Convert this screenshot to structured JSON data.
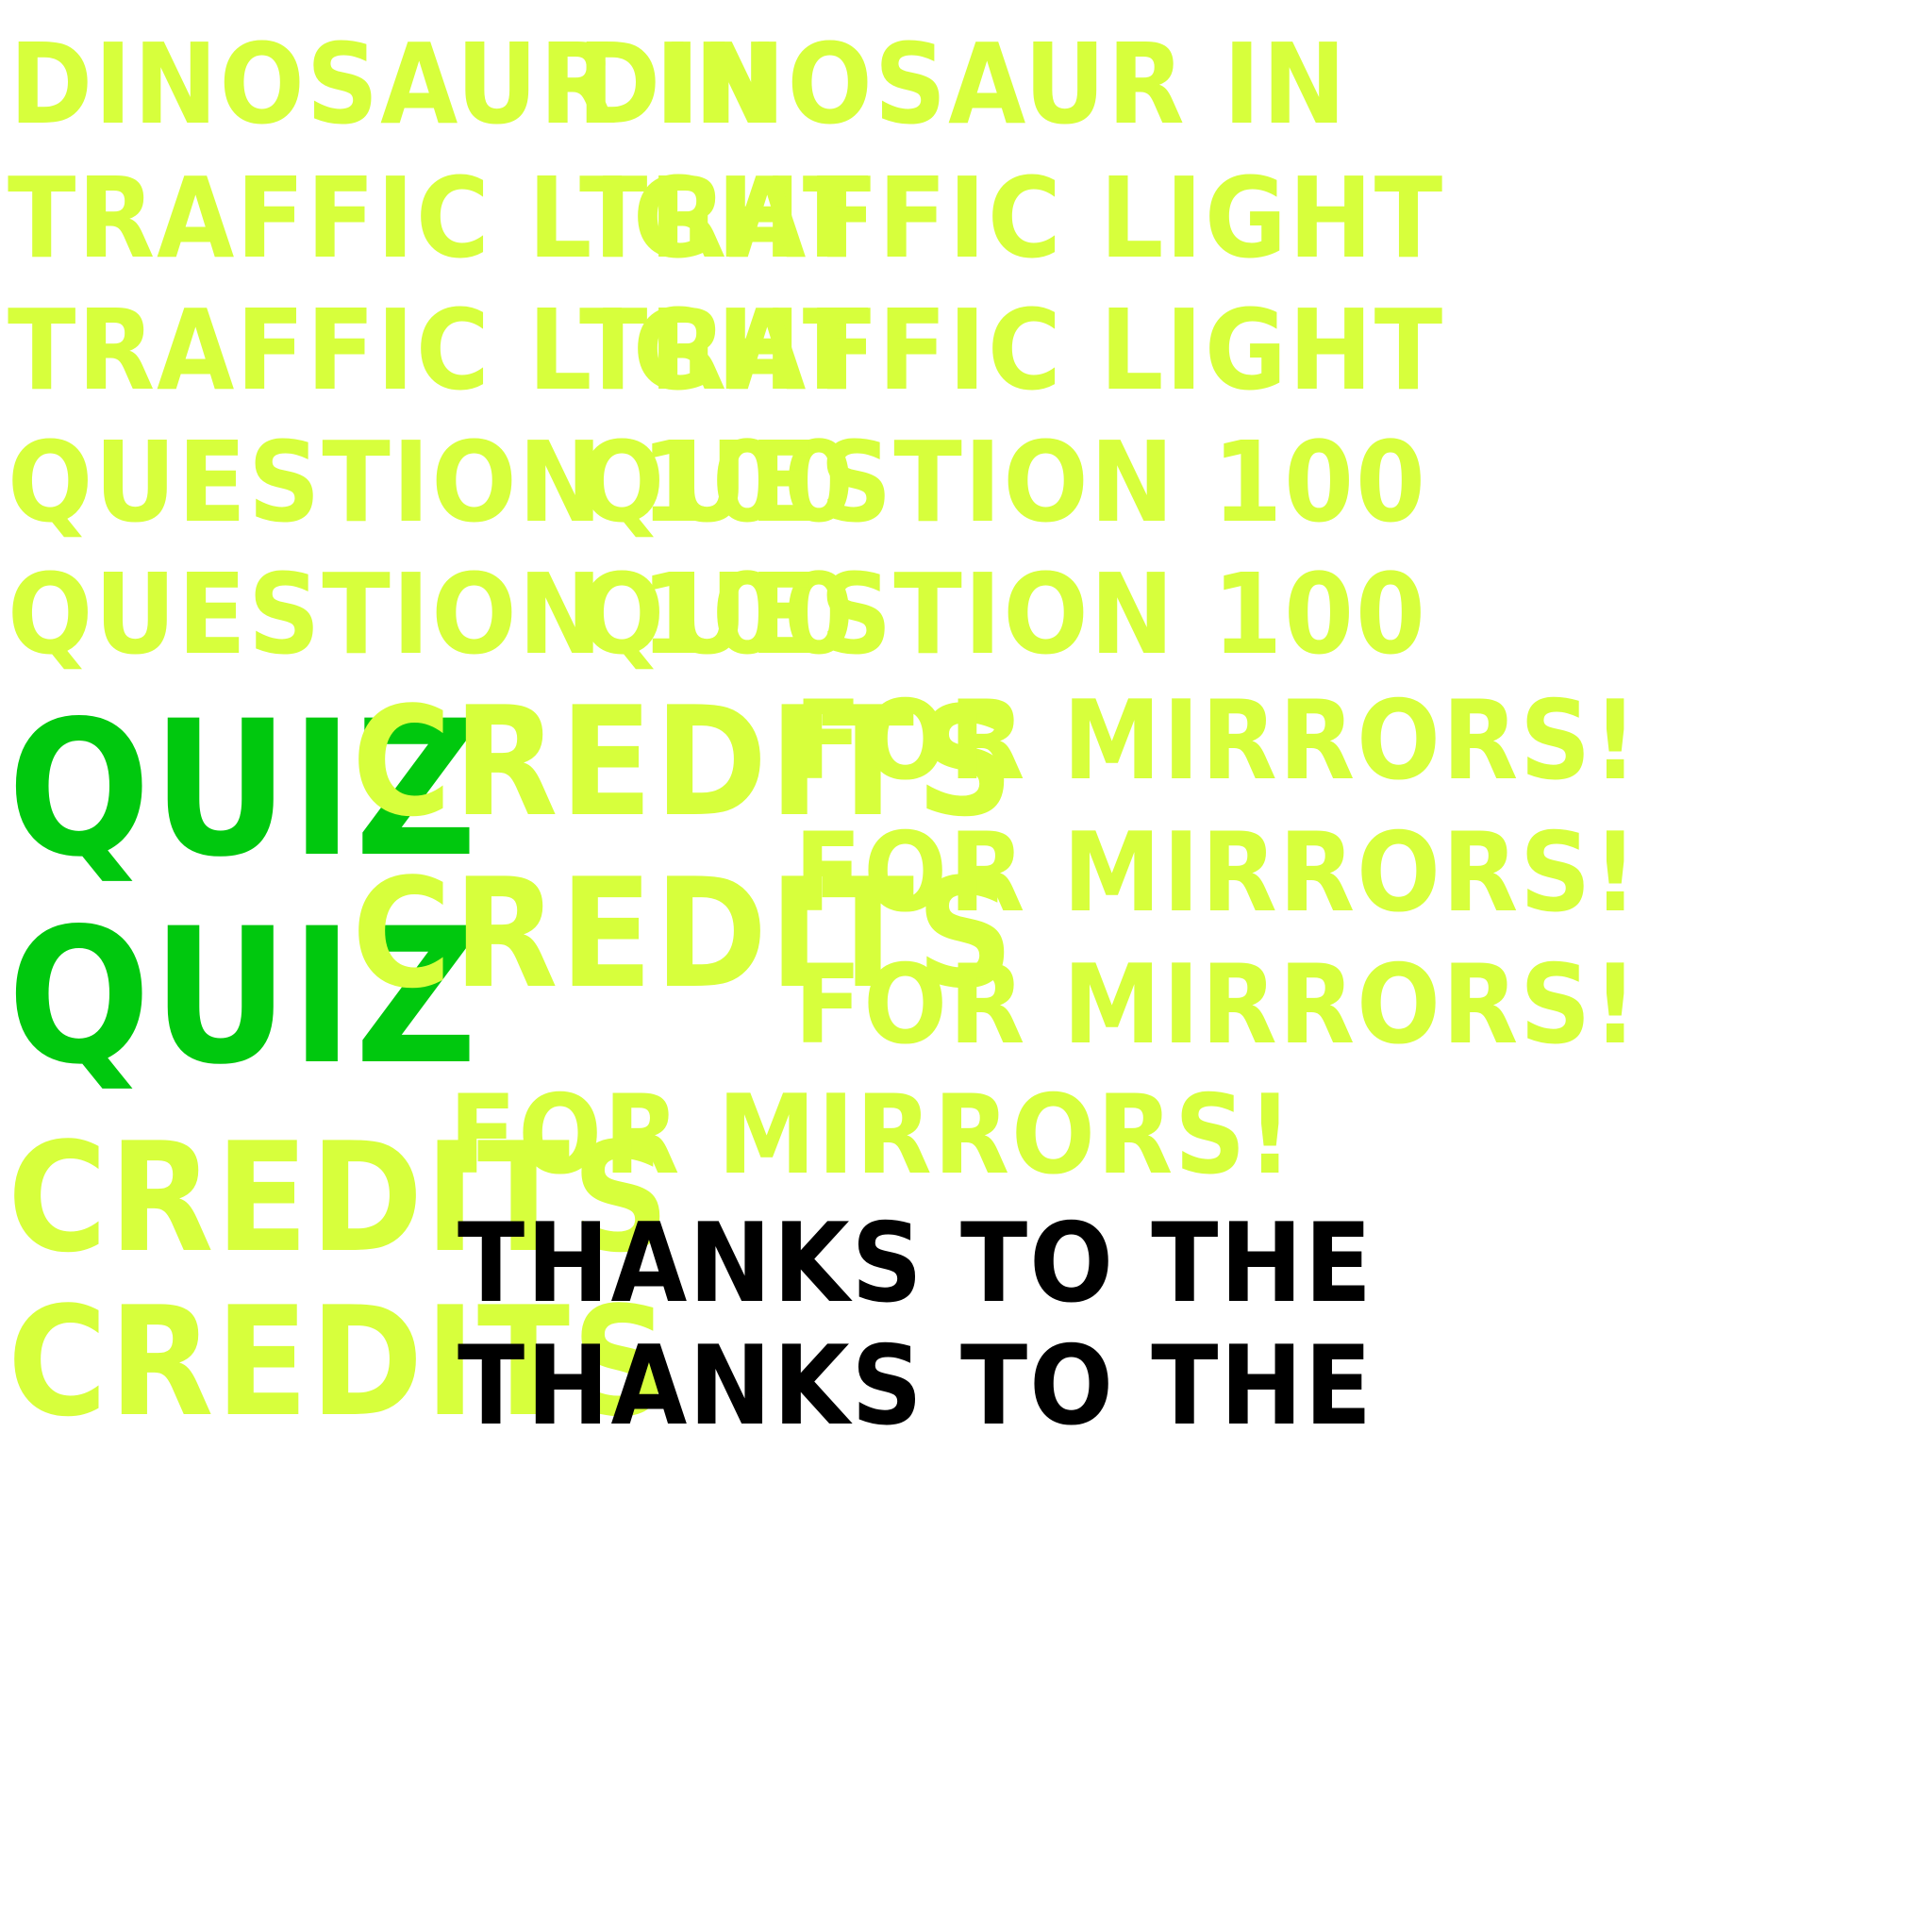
{
  "colors": {
    "lime": "#d7ff3c",
    "green": "#00c80e",
    "black": "#000000",
    "background": "#ffffff"
  },
  "lines": {
    "dino": "DINOSAUR IN",
    "traffic": "TRAFFIC LIGHT",
    "question": "QUESTION 100",
    "quiz": "QUIZ",
    "credits": "CREDITS",
    "mirrors": "FOR MIRRORS!",
    "thanks": "THANKS TO THE"
  }
}
